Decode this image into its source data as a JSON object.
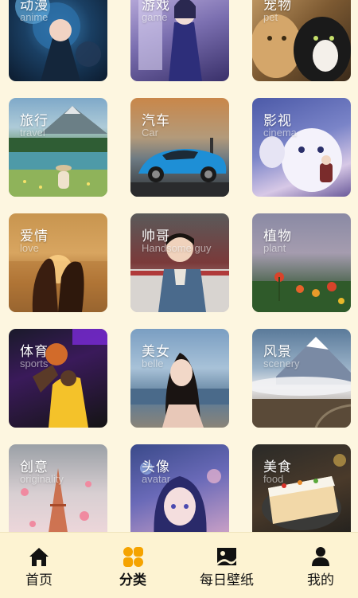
{
  "categories": [
    [
      {
        "title": "动漫",
        "subtitle": "anime"
      },
      {
        "title": "游戏",
        "subtitle": "game"
      },
      {
        "title": "宠物",
        "subtitle": "pet"
      }
    ],
    [
      {
        "title": "旅行",
        "subtitle": "travel"
      },
      {
        "title": "汽车",
        "subtitle": "Car"
      },
      {
        "title": "影视",
        "subtitle": "cinema"
      }
    ],
    [
      {
        "title": "爱情",
        "subtitle": "love"
      },
      {
        "title": "帅哥",
        "subtitle": "Handsome guy"
      },
      {
        "title": "植物",
        "subtitle": "plant"
      }
    ],
    [
      {
        "title": "体育",
        "subtitle": "sports"
      },
      {
        "title": "美女",
        "subtitle": "belle"
      },
      {
        "title": "风景",
        "subtitle": "scenery"
      }
    ],
    [
      {
        "title": "创意",
        "subtitle": "originality"
      },
      {
        "title": "头像",
        "subtitle": "avatar"
      },
      {
        "title": "美食",
        "subtitle": "food"
      }
    ]
  ],
  "nav": {
    "home": "首页",
    "category": "分类",
    "daily": "每日壁纸",
    "mine": "我的"
  },
  "colors": {
    "background": "#fdf6e0",
    "navbar": "#fdf3d2",
    "active_icon": "#f5a300",
    "icon": "#111111"
  },
  "active_tab": "category"
}
